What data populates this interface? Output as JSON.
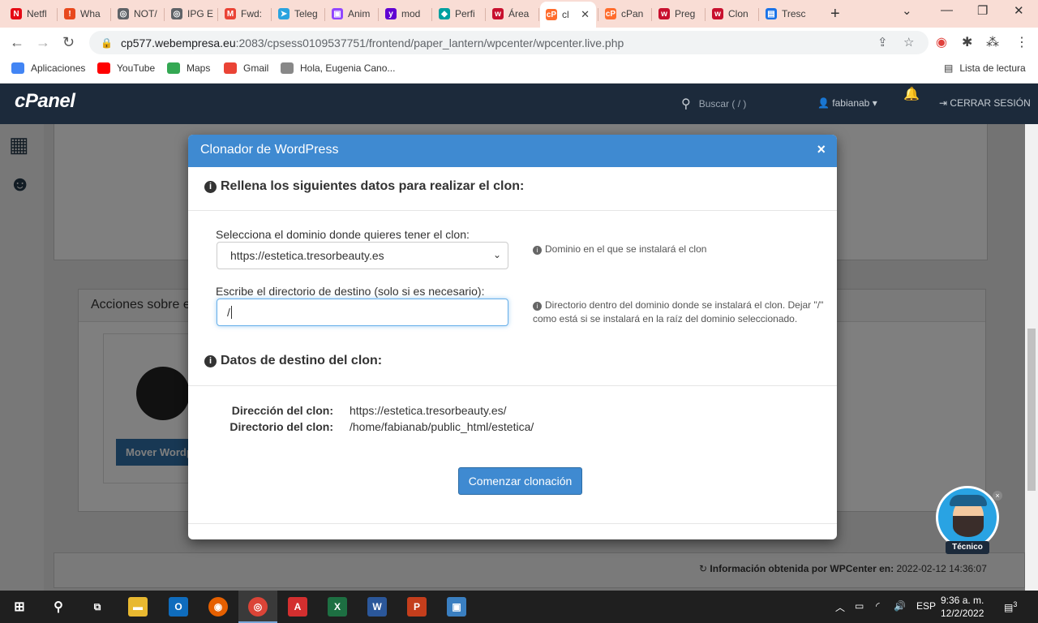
{
  "browser": {
    "tabs": [
      {
        "label": "Netfl",
        "color": "#e50914",
        "glyph": "N"
      },
      {
        "label": "Wha",
        "color": "#e8491d",
        "glyph": "!"
      },
      {
        "label": "NOT/",
        "color": "#5f6368",
        "glyph": "◎"
      },
      {
        "label": "IPG E",
        "color": "#5f6368",
        "glyph": "◎"
      },
      {
        "label": "Fwd:",
        "color": "#ea4335",
        "glyph": "M"
      },
      {
        "label": "Teleg",
        "color": "#2aa3df",
        "glyph": "➤"
      },
      {
        "label": "Anim",
        "color": "#9146ff",
        "glyph": "▣"
      },
      {
        "label": "mod",
        "color": "#6001d2",
        "glyph": "y"
      },
      {
        "label": "Perfi",
        "color": "#00a0a0",
        "glyph": "◆"
      },
      {
        "label": "Área",
        "color": "#c8102e",
        "glyph": "w"
      },
      {
        "label": "cl",
        "color": "#ff6c2c",
        "glyph": "cP",
        "active": true
      },
      {
        "label": "cPan",
        "color": "#ff6c2c",
        "glyph": "cP"
      },
      {
        "label": "Preg",
        "color": "#c8102e",
        "glyph": "w"
      },
      {
        "label": "Clon",
        "color": "#c8102e",
        "glyph": "w"
      },
      {
        "label": "Tresc",
        "color": "#1a73e8",
        "glyph": "▤"
      }
    ],
    "url_host": "cp577.webempresa.eu",
    "url_path": ":2083/cpsess0109537751/frontend/paper_lantern/wpcenter/wpcenter.live.php",
    "bookmarks": [
      {
        "label": "Aplicaciones",
        "color": "#4285f4"
      },
      {
        "label": "YouTube",
        "color": "#ff0000"
      },
      {
        "label": "Maps",
        "color": "#34a853"
      },
      {
        "label": "Gmail",
        "color": "#ea4335"
      },
      {
        "label": "Hola, Eugenia Cano...",
        "color": "#888888"
      }
    ],
    "reading_list": "Lista de lectura"
  },
  "cpanel": {
    "logo": "cPanel",
    "search_placeholder": "Buscar ( / )",
    "user": "fabianab",
    "logout": "CERRAR SESIÓN",
    "actions_panel_title": "Acciones sobre e",
    "move_button": "Mover Wordp",
    "footer_label": "Información obtenida por WPCenter en:",
    "footer_date": "2022-02-12 14:36:07"
  },
  "modal": {
    "title": "Clonador de WordPress",
    "section1_title": "Rellena los siguientes datos para realizar el clon:",
    "domain_label": "Selecciona el dominio donde quieres tener el clon:",
    "domain_value": "https://estetica.tresorbeauty.es",
    "domain_help": "Dominio en el que se instalará el clon",
    "dir_label": "Escribe el directorio de destino (solo si es necesario):",
    "dir_value": "/",
    "dir_help": "Directorio dentro del dominio donde se instalará el clon. Dejar \"/\" como está si se instalará en la raíz del dominio seleccionado.",
    "section2_title": "Datos de destino del clon:",
    "dest_address_label": "Dirección del clon:",
    "dest_address_value": "https://estetica.tresorbeauty.es/",
    "dest_dir_label": "Directorio del clon:",
    "dest_dir_value": "/home/fabianab/public_html/estetica/",
    "start_button": "Comenzar clonación"
  },
  "support": {
    "label": "Técnico"
  },
  "taskbar": {
    "lang": "ESP",
    "time": "9:36 a. m.",
    "date": "12/2/2022",
    "notifications": "3"
  }
}
